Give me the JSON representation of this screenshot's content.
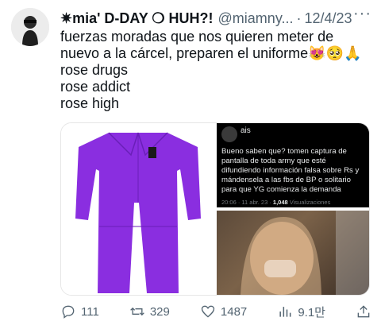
{
  "tweet": {
    "display_name": "✷mia' D-DAY ❍ HUH?!",
    "handle": "@miamny...",
    "separator": "·",
    "date": "12/4/23",
    "more": "···",
    "body_lines": [
      "fuerzas moradas que nos quieren meter de nuevo a la cárcel, preparen el uniforme😻🥺🙏",
      "rose drugs",
      "rose addict",
      "rose high"
    ]
  },
  "media": {
    "left_image": "purple-jumpsuit",
    "right_top": {
      "username": "ais",
      "text": "Bueno saben que? tomen captura de pantalla de toda army que esté difundiendo información falsa sobre Rs y mándensela a las fbs de BP o solitario para que YG comienza la demanda",
      "meta_time": "20:06 · 11 abr. 23 · ",
      "meta_views_count": "1,048",
      "meta_views_label": " Visualizaciones"
    },
    "right_bottom": "photo"
  },
  "actions": {
    "replies": "111",
    "retweets": "329",
    "likes": "1487",
    "views": "9.1만"
  },
  "colors": {
    "jumpsuit": "#8a2ee0",
    "secondary_text": "#536471"
  }
}
